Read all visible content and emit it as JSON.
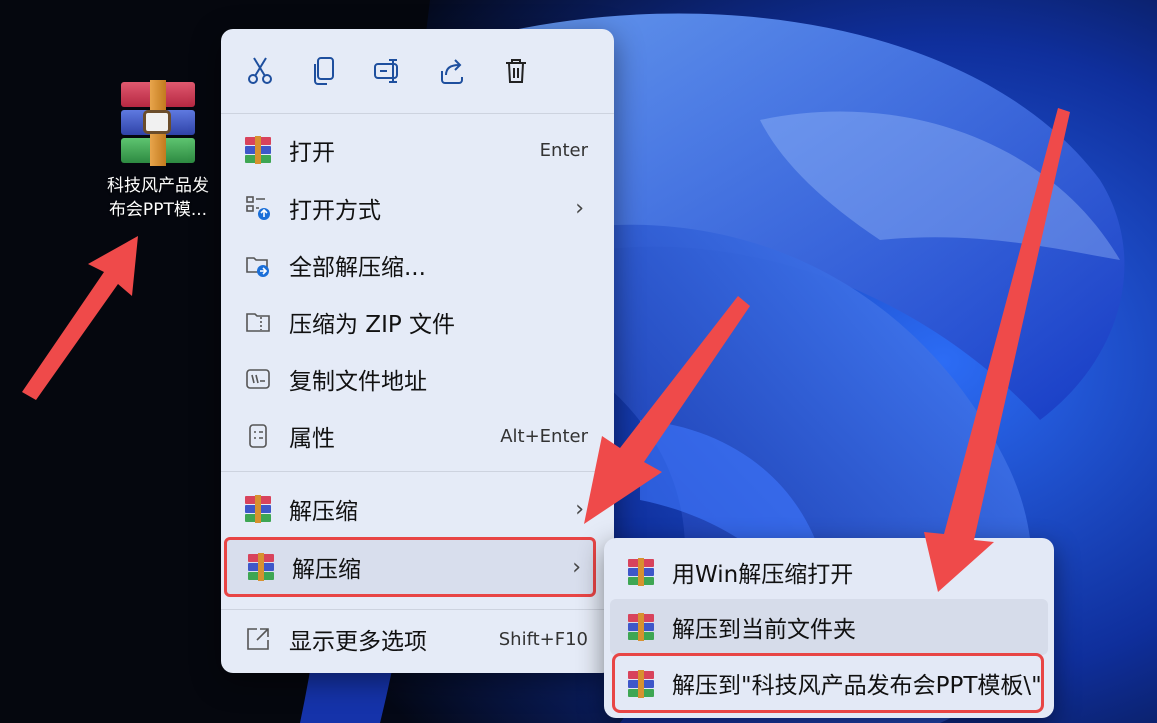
{
  "desktop": {
    "file_icon": "winrar-archive-icon",
    "file_label_line1": "科技风产品发",
    "file_label_line2": "布会PPT模..."
  },
  "toolbar": {
    "icons": [
      "cut-icon",
      "copy-icon",
      "rename-icon",
      "share-icon",
      "delete-icon"
    ]
  },
  "menu": {
    "items": [
      {
        "label": "打开",
        "accel": "Enter",
        "icon": "winrar-icon"
      },
      {
        "label": "打开方式",
        "icon": "open-with-icon"
      },
      {
        "label": "全部解压缩...",
        "icon": "extract-all-icon"
      },
      {
        "label": "压缩为 ZIP 文件",
        "icon": "zip-folder-icon"
      },
      {
        "label": "复制文件地址",
        "icon": "copy-path-icon"
      },
      {
        "label": "属性",
        "accel": "Alt+Enter",
        "icon": "properties-icon"
      },
      {
        "label": "解压缩",
        "icon": "winrar-icon"
      },
      {
        "label": "解压缩",
        "icon": "winrar-icon"
      },
      {
        "label": "显示更多选项",
        "accel": "Shift+F10",
        "icon": "more-options-icon"
      }
    ],
    "chevron": "›"
  },
  "submenu": {
    "items": [
      {
        "label": "用Win解压缩打开",
        "icon": "winrar-icon"
      },
      {
        "label": "解压到当前文件夹",
        "icon": "winrar-icon"
      },
      {
        "label": "解压到\"科技风产品发布会PPT模板\\\"",
        "icon": "winrar-icon"
      }
    ]
  },
  "colors": {
    "menu_bg": "#e5ebf7",
    "highlight_border": "#e84545",
    "wallpaper_blue": "#1f4fe0"
  }
}
